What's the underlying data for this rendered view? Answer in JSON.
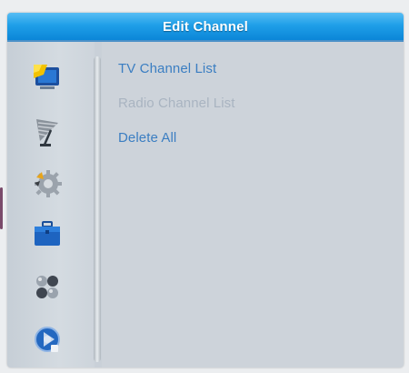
{
  "window": {
    "title": "Edit Channel"
  },
  "sidebar": {
    "items": [
      {
        "icon": "tv-screen-icon",
        "active": true
      },
      {
        "icon": "satellite-dish-icon",
        "active": false
      },
      {
        "icon": "settings-gear-icon",
        "active": false
      },
      {
        "icon": "toolbox-icon",
        "active": false
      },
      {
        "icon": "games-icon",
        "active": false
      },
      {
        "icon": "media-player-icon",
        "active": false
      }
    ]
  },
  "menu": {
    "items": [
      {
        "label": "TV Channel List",
        "state": "active"
      },
      {
        "label": "Radio Channel List",
        "state": "disabled"
      },
      {
        "label": "Delete All",
        "state": "normal"
      }
    ]
  },
  "colors": {
    "title_bar": "#1f9fe8",
    "menu_text": "#3b7ec2",
    "menu_text_disabled": "#a9b4c1",
    "panel_background": "#cdd3da"
  }
}
